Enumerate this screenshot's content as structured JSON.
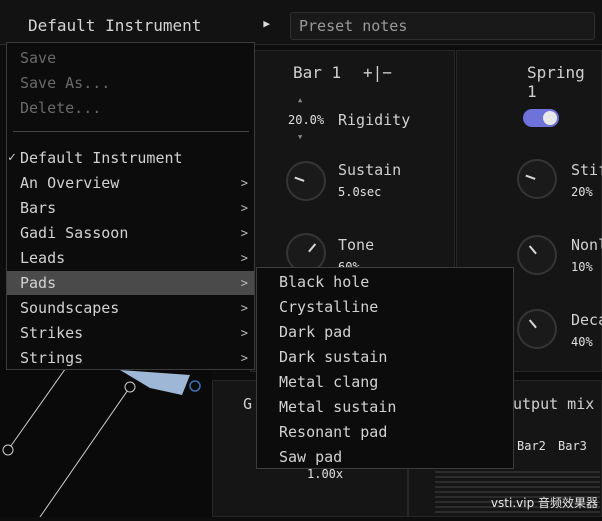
{
  "topbar": {
    "preset_name": "Default Instrument",
    "notes_placeholder": "Preset notes"
  },
  "bar_panel": {
    "title": "Bar 1",
    "add_label": "+|−",
    "rigidity_value": "20.0%",
    "rigidity_label": "Rigidity",
    "sustain_label": "Sustain",
    "sustain_value": "5.0sec",
    "tone_label": "Tone",
    "tone_value": "60%"
  },
  "spring_panel": {
    "title": "Spring 1",
    "toggle_on": true,
    "stiff_label": "Stif",
    "stiff_value": "20%",
    "nonlin_label": "Nonl",
    "nonlin_value": "10%",
    "decay_label": "Deca",
    "decay_value": "40%"
  },
  "bottom": {
    "g_label": "G",
    "scale_value": "1.00x",
    "output_title": "utput mix",
    "channels": [
      "Bar2",
      "Bar3"
    ]
  },
  "menu": {
    "items": [
      {
        "label": "Save",
        "disabled": true
      },
      {
        "label": "Save As...",
        "disabled": true
      },
      {
        "label": "Delete...",
        "disabled": true
      },
      {
        "label": "Default Instrument",
        "checked": true
      },
      {
        "label": "An Overview",
        "submenu": true
      },
      {
        "label": "Bars",
        "submenu": true
      },
      {
        "label": "Gadi Sassoon",
        "submenu": true
      },
      {
        "label": "Leads",
        "submenu": true
      },
      {
        "label": "Pads",
        "submenu": true,
        "highlighted": true
      },
      {
        "label": "Soundscapes",
        "submenu": true
      },
      {
        "label": "Strikes",
        "submenu": true
      },
      {
        "label": "Strings",
        "submenu": true
      }
    ],
    "check_glyph": "✓",
    "submenu_glyph": ">"
  },
  "submenu": {
    "items": [
      "Black hole",
      "Crystalline",
      "Dark pad",
      "Dark sustain",
      "Metal clang",
      "Metal sustain",
      "Resonant pad",
      "Saw pad"
    ]
  },
  "watermark": "vsti.vip 音频效果器",
  "colors": {
    "toggle": "#6f72d8",
    "highlight": "#4a4a4a",
    "canvas_accent": "#9fb7d6"
  }
}
